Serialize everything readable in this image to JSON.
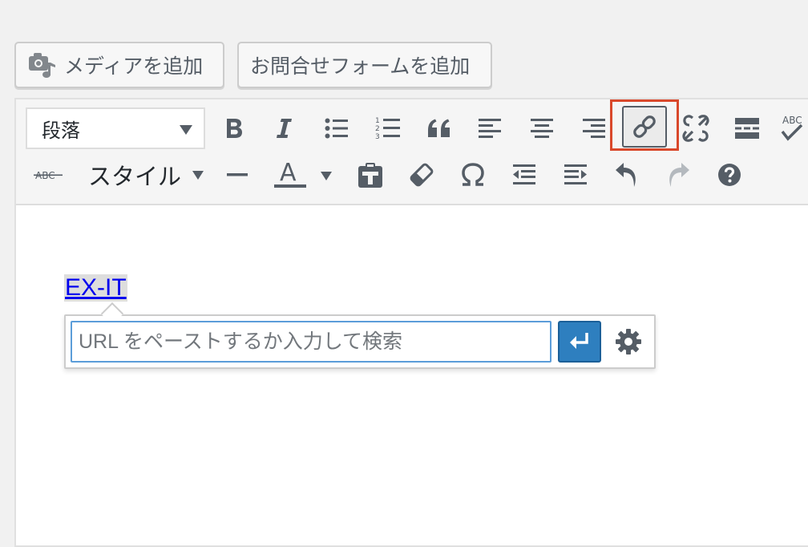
{
  "buttons": {
    "add_media": "メディアを追加",
    "add_form": "お問合せフォームを追加"
  },
  "toolbar": {
    "format_select_value": "段落",
    "style_label": "スタイル",
    "text_color_letter": "A",
    "spellcheck_label": "ABC",
    "strikethrough_label": "ABC",
    "numbered_list_digits": [
      "1",
      "2",
      "3"
    ]
  },
  "editor": {
    "link_text": "EX-IT",
    "link_popover": {
      "url_placeholder": "URL をペーストするか入力して検索",
      "url_value": ""
    }
  },
  "colors": {
    "highlight": "#d9482b",
    "apply_button": "#2e7fbf",
    "link": "#0000ee"
  }
}
